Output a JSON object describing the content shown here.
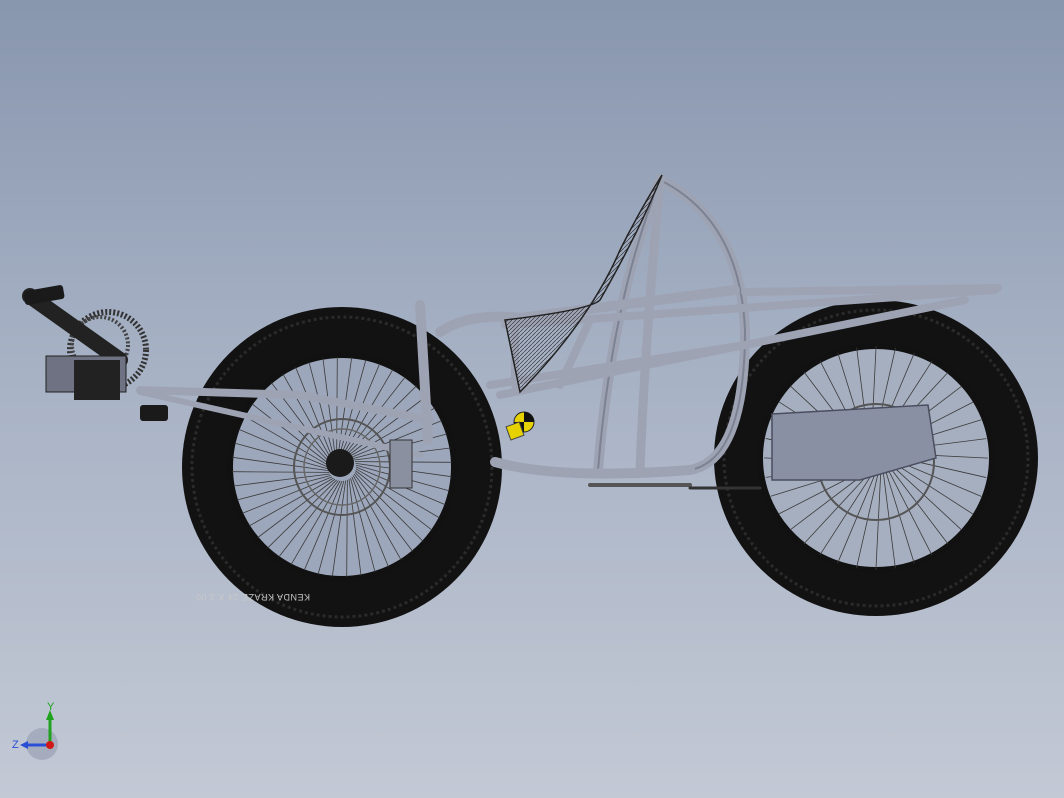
{
  "viewport": {
    "background_top": "#8896ae",
    "background_bottom": "#c3c9d5"
  },
  "model": {
    "frame_color": "#a4a8b8",
    "tire_color": "#141414",
    "front_tire_text": "KENDA KRAZE 24 X 3.00",
    "center_of_mass_icon": "center-of-mass-icon"
  },
  "triad": {
    "y_label": "Y",
    "z_label": "Z",
    "y_color": "#1fa31f",
    "z_color": "#2a4fd6",
    "x_color": "#d01818"
  }
}
